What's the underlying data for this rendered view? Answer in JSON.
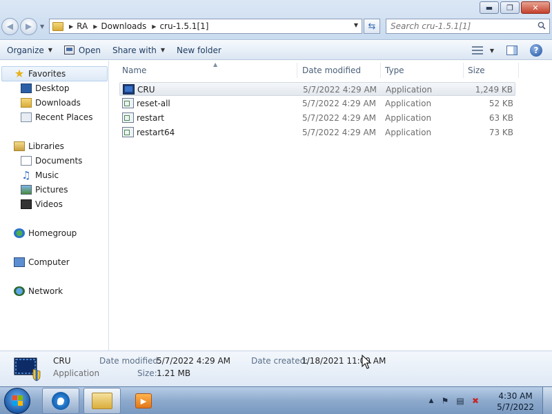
{
  "window": {
    "controls": {
      "minimize": "▬",
      "maximize": "❐",
      "close": "✕"
    }
  },
  "address": {
    "breadcrumbs": [
      "RA",
      "Downloads",
      "cru-1.5.1[1]"
    ],
    "refresh_glyph": "⇆"
  },
  "search": {
    "placeholder": "Search cru-1.5.1[1]"
  },
  "toolbar": {
    "organize": "Organize",
    "open": "Open",
    "share_with": "Share with",
    "new_folder": "New folder",
    "help_glyph": "?"
  },
  "nav": {
    "favorites": "Favorites",
    "desktop": "Desktop",
    "downloads": "Downloads",
    "recent_places": "Recent Places",
    "libraries": "Libraries",
    "documents": "Documents",
    "music": "Music",
    "pictures": "Pictures",
    "videos": "Videos",
    "homegroup": "Homegroup",
    "computer": "Computer",
    "network": "Network"
  },
  "columns": {
    "name": "Name",
    "date": "Date modified",
    "type": "Type",
    "size": "Size"
  },
  "files": [
    {
      "name": "CRU",
      "date": "5/7/2022 4:29 AM",
      "type": "Application",
      "size": "1,249 KB",
      "icon": "cru-icon"
    },
    {
      "name": "reset-all",
      "date": "5/7/2022 4:29 AM",
      "type": "Application",
      "size": "52 KB",
      "icon": "application-icon"
    },
    {
      "name": "restart",
      "date": "5/7/2022 4:29 AM",
      "type": "Application",
      "size": "63 KB",
      "icon": "application-icon"
    },
    {
      "name": "restart64",
      "date": "5/7/2022 4:29 AM",
      "type": "Application",
      "size": "73 KB",
      "icon": "application-icon"
    }
  ],
  "details": {
    "name": "CRU",
    "kind": "Application",
    "date_modified_label": "Date modified:",
    "date_modified": "5/7/2022 4:29 AM",
    "size_label": "Size:",
    "size": "1.21 MB",
    "date_created_label": "Date created:",
    "date_created": "1/18/2021 11:00 AM"
  },
  "taskbar": {
    "ie_glyph": "e",
    "media_glyph": "▶",
    "clock_time": "4:30 AM",
    "clock_date": "5/7/2022"
  }
}
